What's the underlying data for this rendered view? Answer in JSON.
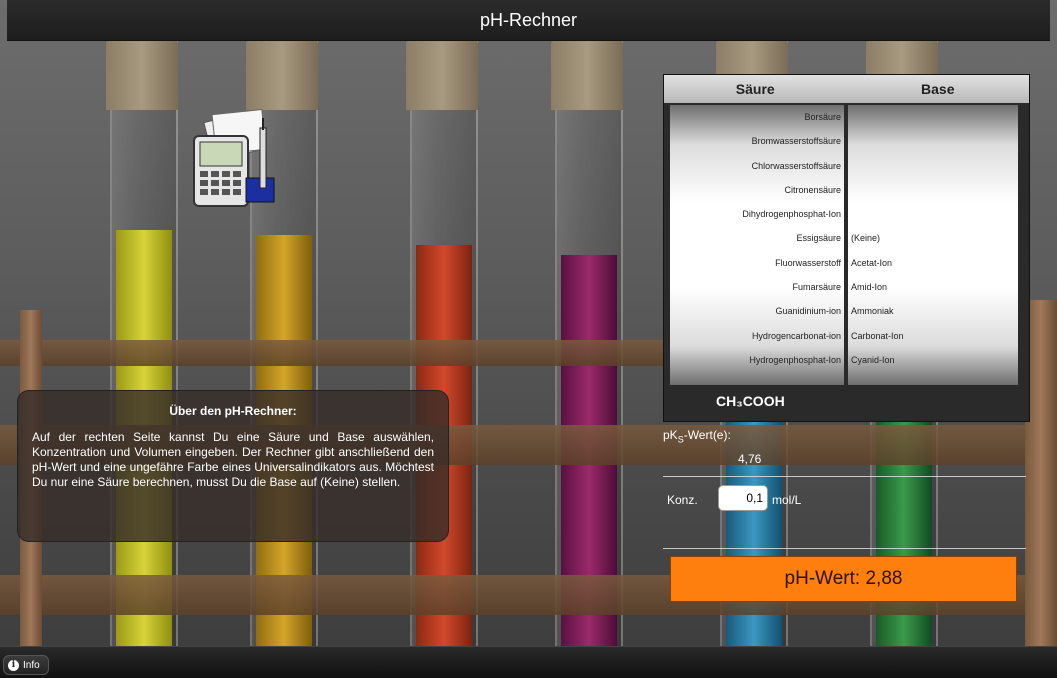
{
  "header": {
    "title": "pH-Rechner"
  },
  "info_box": {
    "title": "Über den pH-Rechner:",
    "text": "Auf der rechten Seite kannst Du eine Säure und Base auswählen, Konzentration und Volumen eingeben. Der Rechner gibt anschließend den pH-Wert und eine ungefähre Farbe eines Universalindikators aus. Möchtest Du nur eine Säure berechnen, musst Du die Base auf (Keine) stellen."
  },
  "picker": {
    "acid_header": "Säure",
    "base_header": "Base",
    "acids": [
      "Borsäure",
      "Bromwasserstoffsäure",
      "Chlorwasserstoffsäure",
      "Citronensäure",
      "Dihydrogenphosphat-Ion",
      "Essigsäure",
      "Fluorwasserstoff",
      "Fumarsäure",
      "Guanidinium-ion",
      "Hydrogencarbonat-ion",
      "Hydrogenphosphat-Ion"
    ],
    "bases": [
      "",
      "",
      "",
      "",
      "",
      "(Keine)",
      "Acetat-Ion",
      "Amid-Ion",
      "Ammoniak",
      "Carbonat-Ion",
      "Cyanid-Ion"
    ],
    "selected_acid": "Essigsäure",
    "selected_base": "(Keine)",
    "formula": "CH₃COOH"
  },
  "pks": {
    "label_main": "pK",
    "label_sub": "S",
    "label_rest": "-Wert(e):",
    "value": "4,76"
  },
  "concentration": {
    "label": "Konz.",
    "value": "0,1",
    "unit": "mol/L"
  },
  "result": {
    "text": "pH-Wert: 2,88",
    "color": "#ff7f0e"
  },
  "footer": {
    "info_label": "Info"
  }
}
